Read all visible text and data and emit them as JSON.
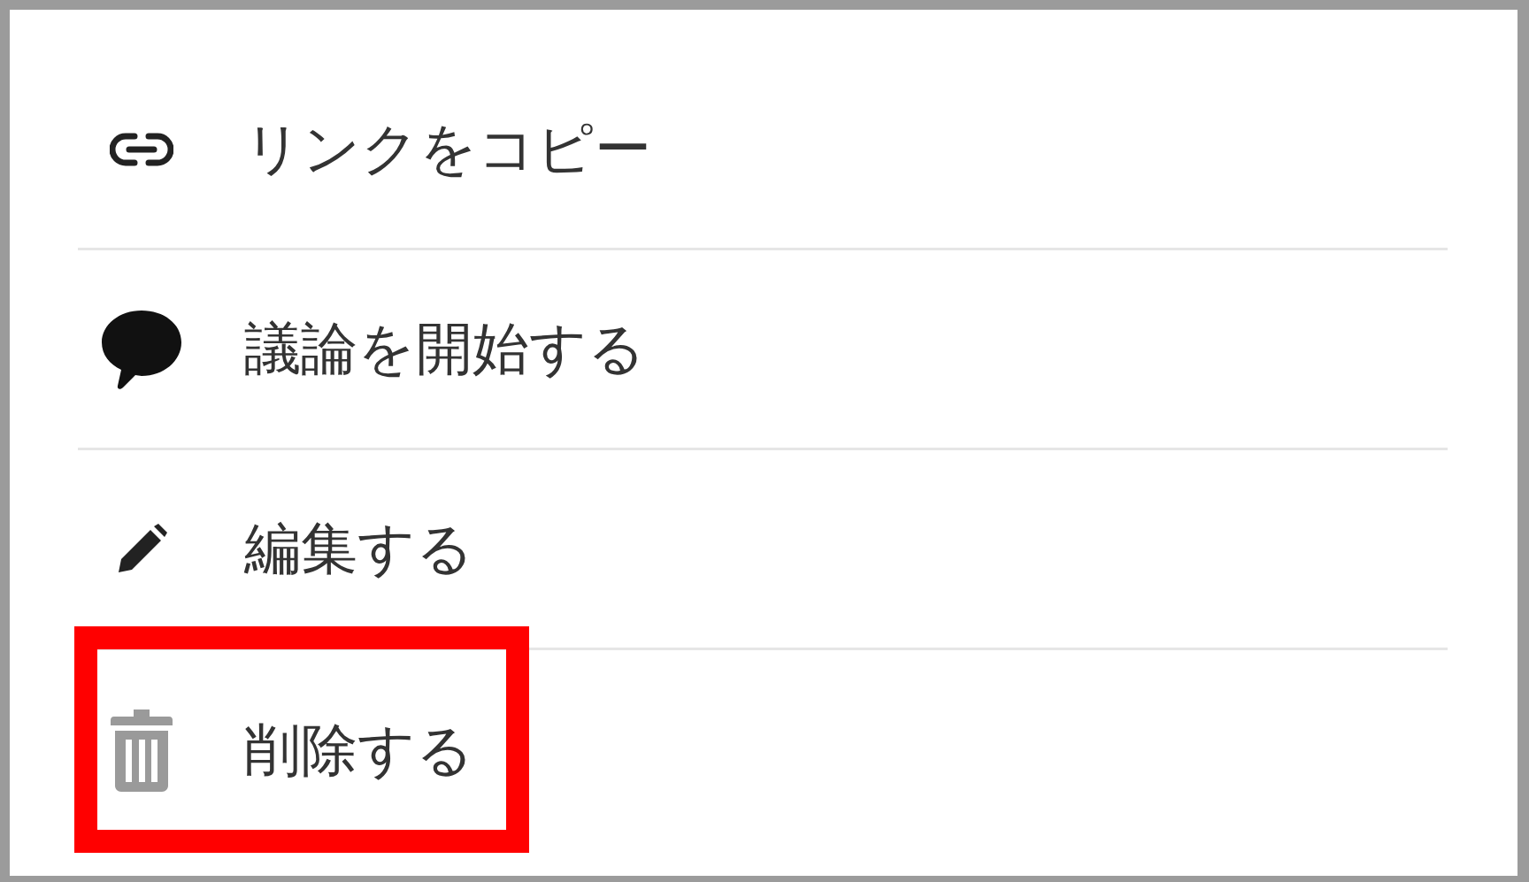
{
  "menu": {
    "items": [
      {
        "label": "リンクをコピー",
        "highlighted": false
      },
      {
        "label": "議論を開始する",
        "highlighted": false
      },
      {
        "label": "編集する",
        "highlighted": false
      },
      {
        "label": "削除する",
        "highlighted": true
      }
    ]
  }
}
